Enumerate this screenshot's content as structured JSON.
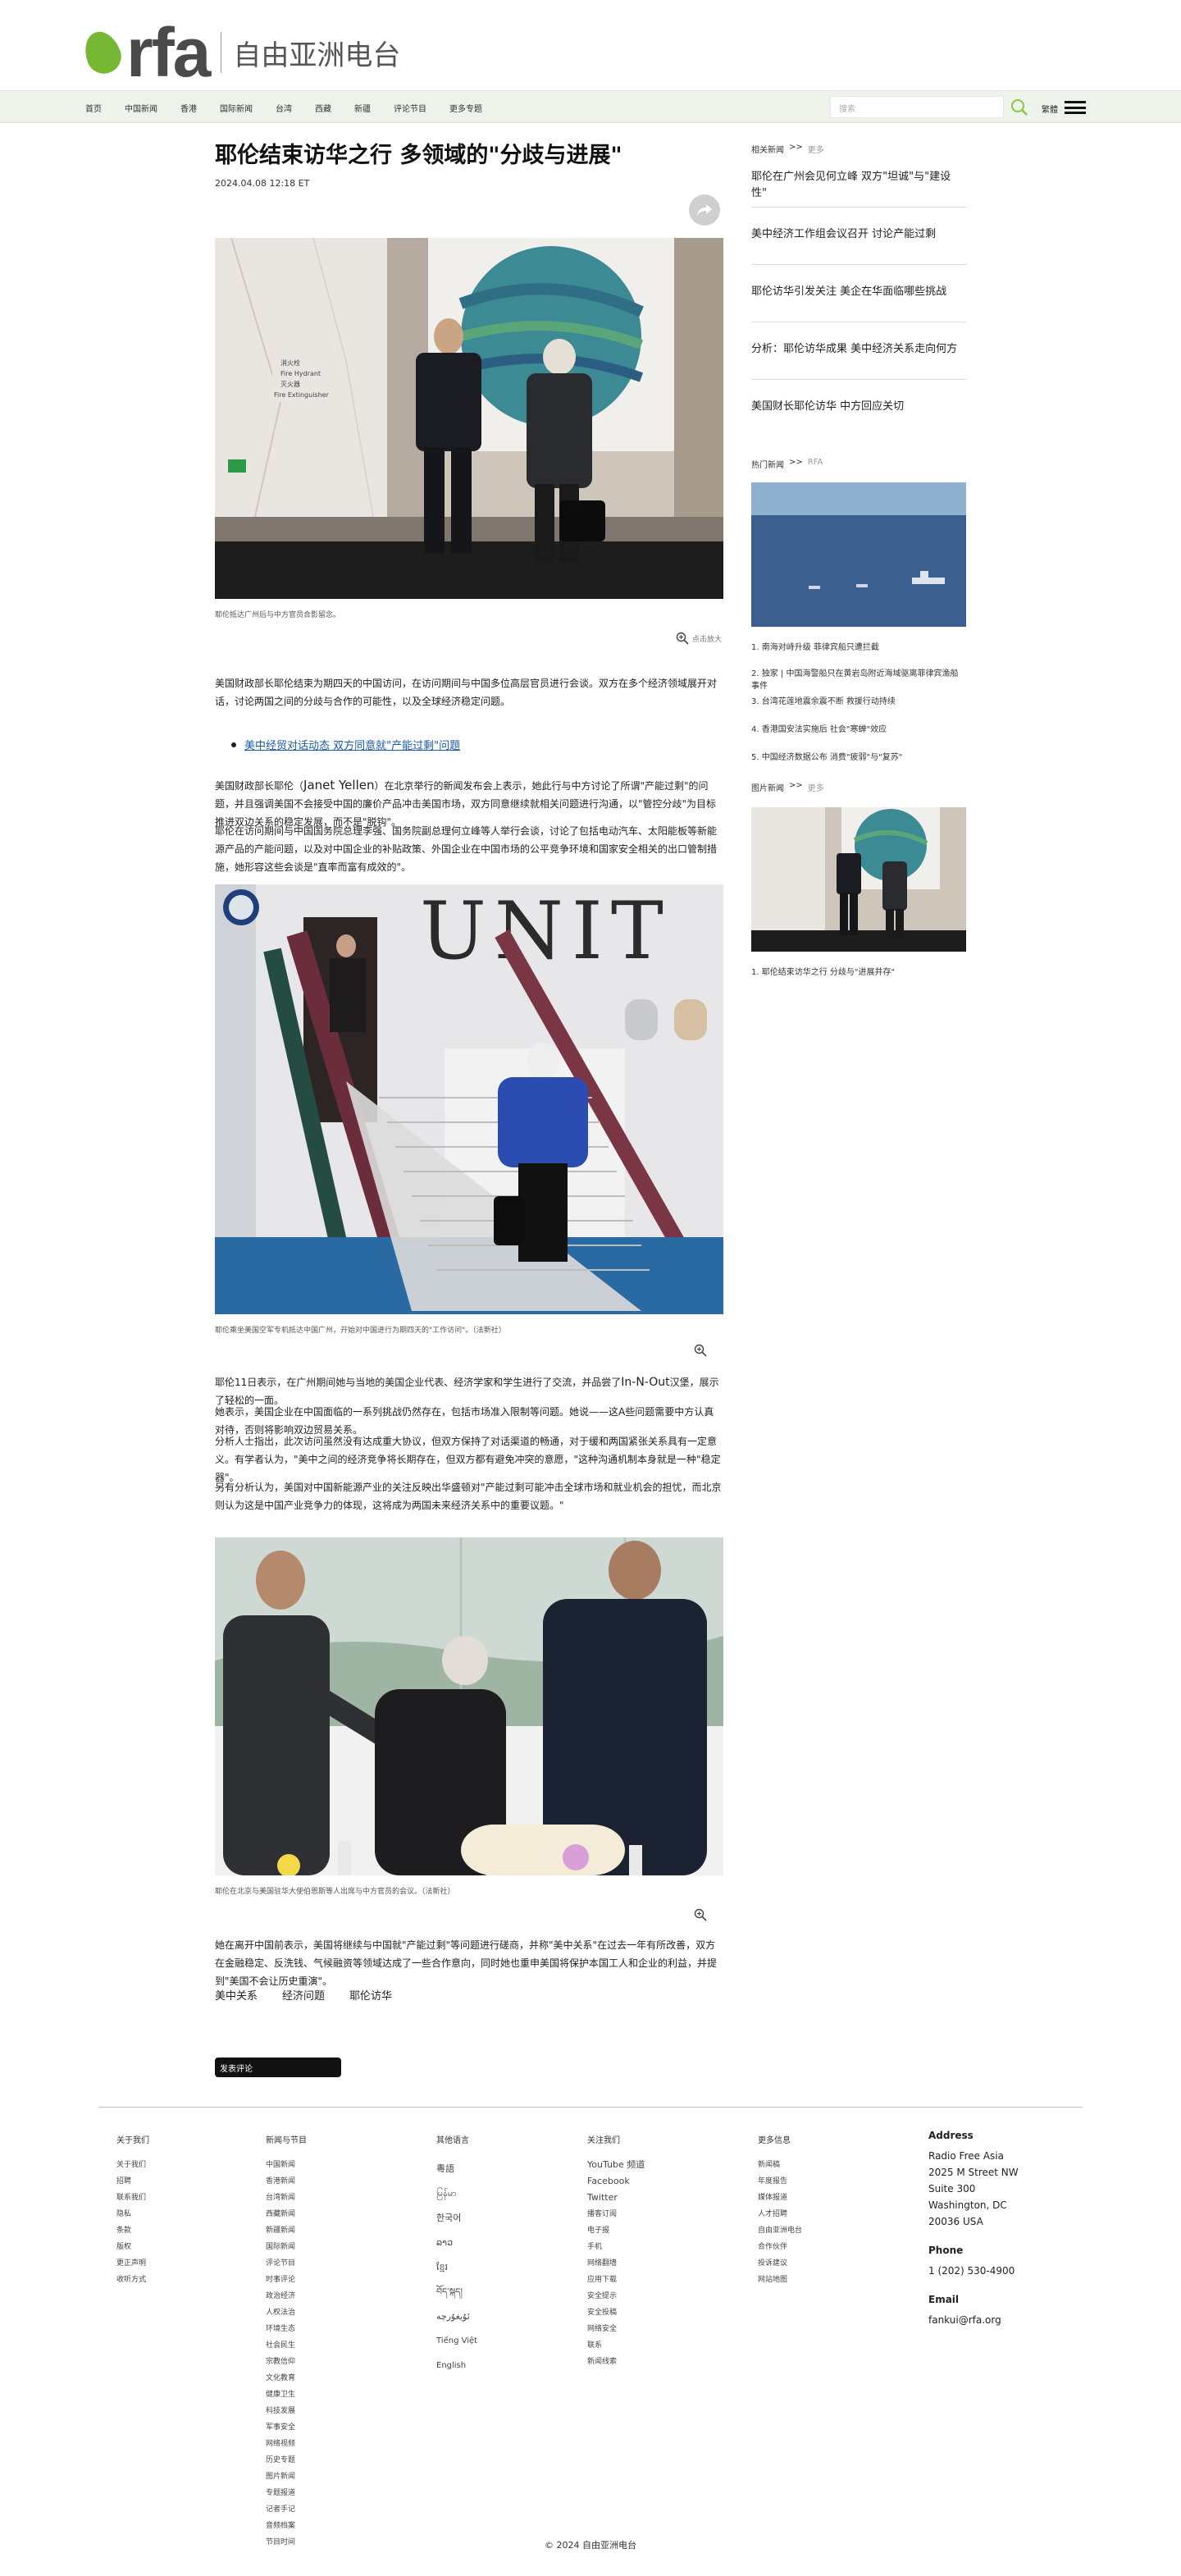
{
  "header": {
    "logo_text": "rfa",
    "logo_cn": "自由亚洲电台",
    "nav": [
      "首页",
      "中国新闻",
      "香港",
      "国际新闻",
      "台湾",
      "西藏",
      "新疆",
      "评论节目",
      "更多专题"
    ],
    "search_placeholder": "搜索",
    "lang_switch": "繁體"
  },
  "article": {
    "title": "耶伦结束访华之行  多领域的\"分歧与进展\"",
    "date": "2024.04.08 12:18 ET",
    "photo1_caption": "耶伦抵达广州后与中方官员合影留念。",
    "zoom_label": "点击放大",
    "para1": "美国财政部长耶伦结束为期四天的中国访问，在访问期间与中国多位高层官员进行会谈。双方在多个经济领域展开对话，讨论两国之间的分歧与合作的可能性，以及全球经济稳定问题。",
    "related_link": "美中经贸对话动态 双方同意就\"产能过剩\"问题",
    "para2_pre": "美国财政部长耶伦（",
    "para2_name": "Janet Yellen",
    "para2_post": "）在北京举行的新闻发布会上表示，她此行与中方讨论了所谓\"产能过剩\"的问题，并且强调美国不会接受中国的廉价产品冲击美国市场，双方同意继续就相关问题进行沟通，以\"管控分歧\"为目标推进双边关系的稳定发展，而不是\"脱钩\"。",
    "para3": "耶伦在访问期间与中国国务院总理李强、国务院副总理何立峰等人举行会谈，讨论了包括电动汽车、太阳能板等新能源产品的产能问题，以及对中国企业的补贴政策、外国企业在中国市场的公平竞争环境和国家安全相关的出口管制措施，她形容这些会谈是\"直率而富有成效的\"。",
    "photo2_caption": "耶伦乘坐美国空军专机抵达中国广州，开始对中国进行为期四天的\"工作访问\"。（法新社）",
    "para4_pre": "耶伦11日表示，在广州期间她与当地的美国企业代表、经济学家和学生进行了交流，并品尝了",
    "para4_brand": "In-N-Out",
    "para4_post": "汉堡，展示了轻松的一面。",
    "para5": "她表示，美国企业在中国面临的一系列挑战仍然存在，包括市场准入限制等问题。她说——这A些问题需要中方认真对待，否则将影响双边贸易关系。",
    "para6": "分析人士指出，此次访问虽然没有达成重大协议，但双方保持了对话渠道的畅通，对于缓和两国紧张关系具有一定意义。有学者认为，\"美中之间的经济竞争将长期存在，但双方都有避免冲突的意愿，\"这种沟通机制本身就是一种\"稳定器\"。",
    "para7": "另有分析认为，美国对中国新能源产业的关注反映出华盛顿对\"产能过剩可能冲击全球市场和就业机会的担忧，而北京则认为这是中国产业竞争力的体现，这将成为两国未来经济关系中的重要议题。\"",
    "photo3_caption": "耶伦在北京与美国驻华大使伯恩斯等人出席与中方官员的会议。（法新社）",
    "para8": "她在离开中国前表示，美国将继续与中国就\"产能过剩\"等问题进行磋商，并称\"美中关系\"在过去一年有所改善，双方在金融稳定、反洗钱、气候融资等领域达成了一些合作意向，同时她也重申美国将保护本国工人和企业的利益，并提到\"美国不会让历史重演\"。",
    "tags": [
      "美中关系",
      "经济问题",
      "耶伦访华"
    ],
    "comment_button": "发表评论"
  },
  "sidebar": {
    "section1_label": "相关新闻",
    "section1_sub": "更多",
    "related": [
      "耶伦在广州会见何立峰    双方\"坦诚\"与\"建设性\"",
      "美中经济工作组会议召开    讨论产能过剩",
      "耶伦访华引发关注    美企在华面临哪些挑战",
      "分析：耶伦访华成果    美中经济关系走向何方",
      "美国财长耶伦访华    中方回应关切"
    ],
    "section2_label": "热门新闻",
    "section2_sub": "RFA",
    "ranked": [
      "1. 南海对峙升级 菲律宾船只遭拦截",
      "2. 独家 | 中国海警船只在黄岩岛附近海域驱离菲律宾渔船事件",
      "3. 台湾花莲地震余震不断    救援行动持续",
      "4. 香港国安法实施后    社会\"寒蝉\"效应",
      "5. 中国经济数据公布    消费\"疲弱\"与\"复苏\""
    ],
    "section3_label": "图片新闻",
    "section3_sub": "更多",
    "pic_item": "1. 耶伦结束访华之行  分歧与\"进展并存\""
  },
  "footer": {
    "col1_head": "关于我们",
    "col1": [
      "关于我们",
      "招聘",
      "联系我们",
      "隐私",
      "条款",
      "版权",
      "更正声明",
      "收听方式"
    ],
    "col2_head": "新闻与节目",
    "col2": [
      "中国新闻",
      "香港新闻",
      "台湾新闻",
      "西藏新闻",
      "新疆新闻",
      "国际新闻",
      "评论节目",
      "时事评论",
      "政治经济",
      "人权法治",
      "环境生态",
      "社会民生",
      "宗教信仰",
      "文化教育",
      "健康卫生",
      "科技发展",
      "军事安全",
      "网络视频",
      "历史专题",
      "图片新闻",
      "专题报道",
      "记者手记",
      "音频档案",
      "节目时间"
    ],
    "col3_head": "其他语言",
    "col3": [
      "粵語",
      "မြန်မာ",
      "한국어",
      "ລາວ",
      "ខ្មែរ",
      "བོད་སྐད།",
      "ئۇيغۇرچە",
      "Tiếng Việt",
      "English"
    ],
    "col4_head": "关注我们",
    "col4": [
      "YouTube 频道",
      "Facebook",
      "Twitter",
      "播客订阅",
      "电子报",
      "手机",
      "网络翻墙",
      "应用下载",
      "安全提示",
      "安全投稿",
      "网络安全",
      "联系",
      "新闻线索"
    ],
    "col5_head": "更多信息",
    "col5": [
      "新闻稿",
      "年度报告",
      "媒体报道",
      "人才招聘",
      "自由亚洲电台",
      "合作伙伴",
      "投诉建议",
      "网站地图"
    ],
    "address_head": "Address",
    "address": [
      "Radio Free Asia",
      "2025 M Street NW",
      "Suite 300",
      "Washington, DC",
      "20036 USA"
    ],
    "phone_head": "Phone",
    "phone": "1 (202) 530-4900",
    "email_head": "Email",
    "email": "fankui@rfa.org",
    "copyright": "© 2024 自由亚洲电台"
  }
}
